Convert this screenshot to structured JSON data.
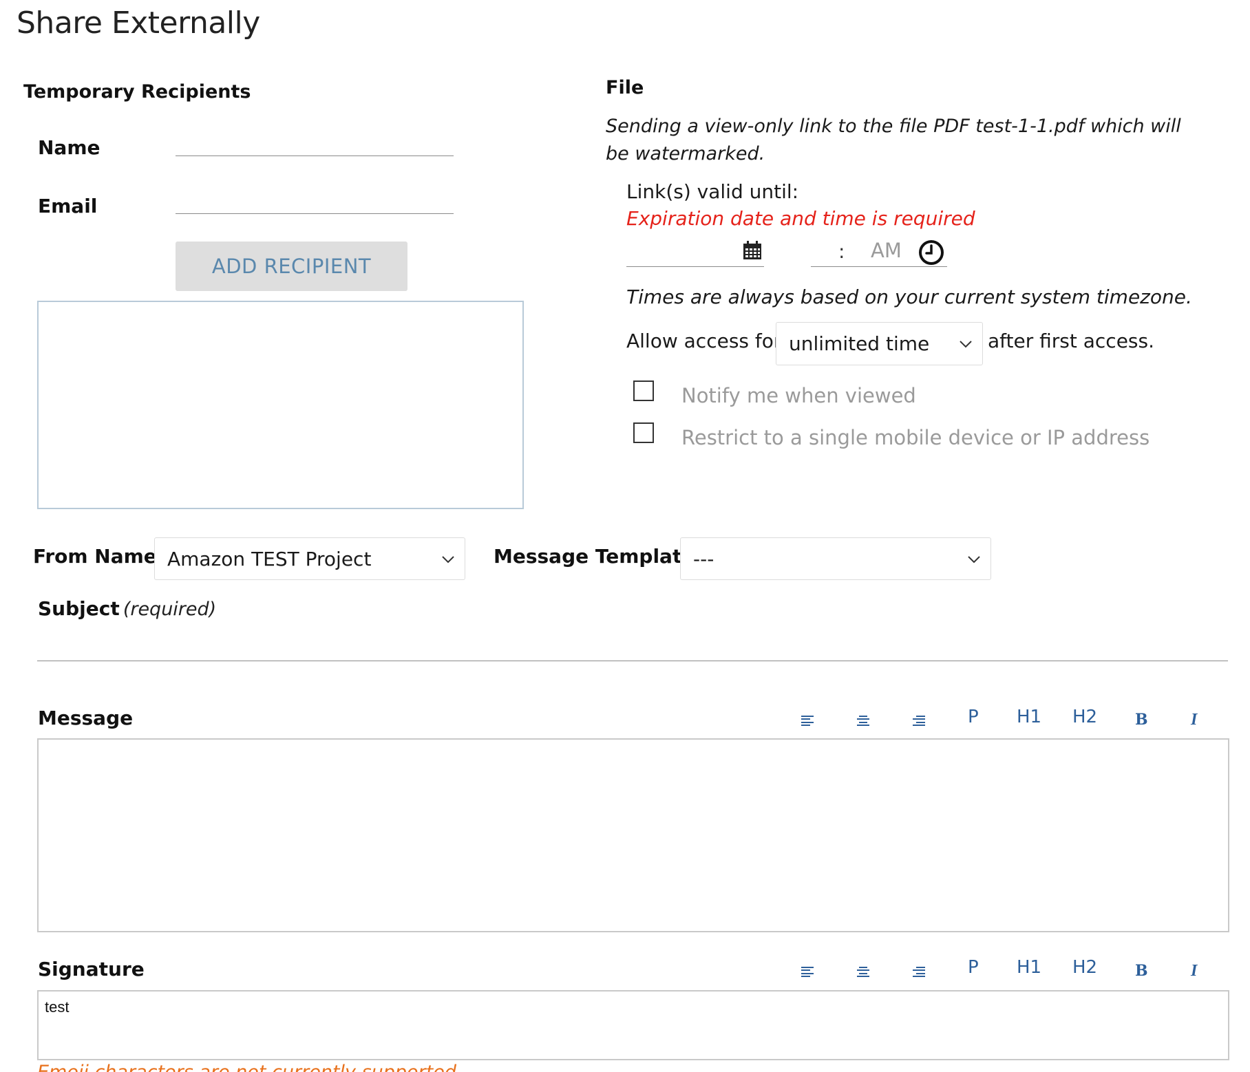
{
  "page": {
    "title": "Share Externally"
  },
  "recipients": {
    "heading": "Temporary Recipients",
    "name_label": "Name",
    "name_value": "",
    "email_label": "Email",
    "email_value": "",
    "add_button": "ADD RECIPIENT"
  },
  "file": {
    "heading": "File",
    "description": "Sending a view-only link to the file PDF test-1-1.pdf which will be watermarked.",
    "valid_until_label": "Link(s) valid until:",
    "error": "Expiration date and time is required",
    "date_value": "",
    "time_separator": ":",
    "ampm": "AM",
    "timezone_note": "Times are always based on your current system timezone.",
    "allow_access_prefix": "Allow access for",
    "allow_access_value": "unlimited time",
    "allow_access_suffix": "after first access.",
    "notify_label": "Notify me when viewed",
    "restrict_label": "Restrict to a single mobile device or IP address"
  },
  "from_name": {
    "label": "From Name",
    "value": "Amazon TEST Project"
  },
  "message_template": {
    "label": "Message Template",
    "value": "---"
  },
  "subject": {
    "label": "Subject",
    "hint": "(required)",
    "value": ""
  },
  "message": {
    "label": "Message",
    "value": "",
    "toolbar": {
      "p": "P",
      "h1": "H1",
      "h2": "H2",
      "bold": "B",
      "italic": "I"
    }
  },
  "signature": {
    "label": "Signature",
    "value": "test",
    "toolbar": {
      "p": "P",
      "h1": "H1",
      "h2": "H2",
      "bold": "B",
      "italic": "I"
    },
    "emoji_warning": "Emoji characters are not currently supported"
  },
  "icons": {
    "calendar": "calendar-icon",
    "clock": "clock-icon",
    "chevron": "chevron-down-icon",
    "align_left": "align-left-icon",
    "align_center": "align-center-icon",
    "align_right": "align-right-icon"
  },
  "colors": {
    "error": "#e5221a",
    "warning": "#e8711c",
    "button_text": "#5a88ad",
    "toolbar": "#2d5f9a"
  }
}
